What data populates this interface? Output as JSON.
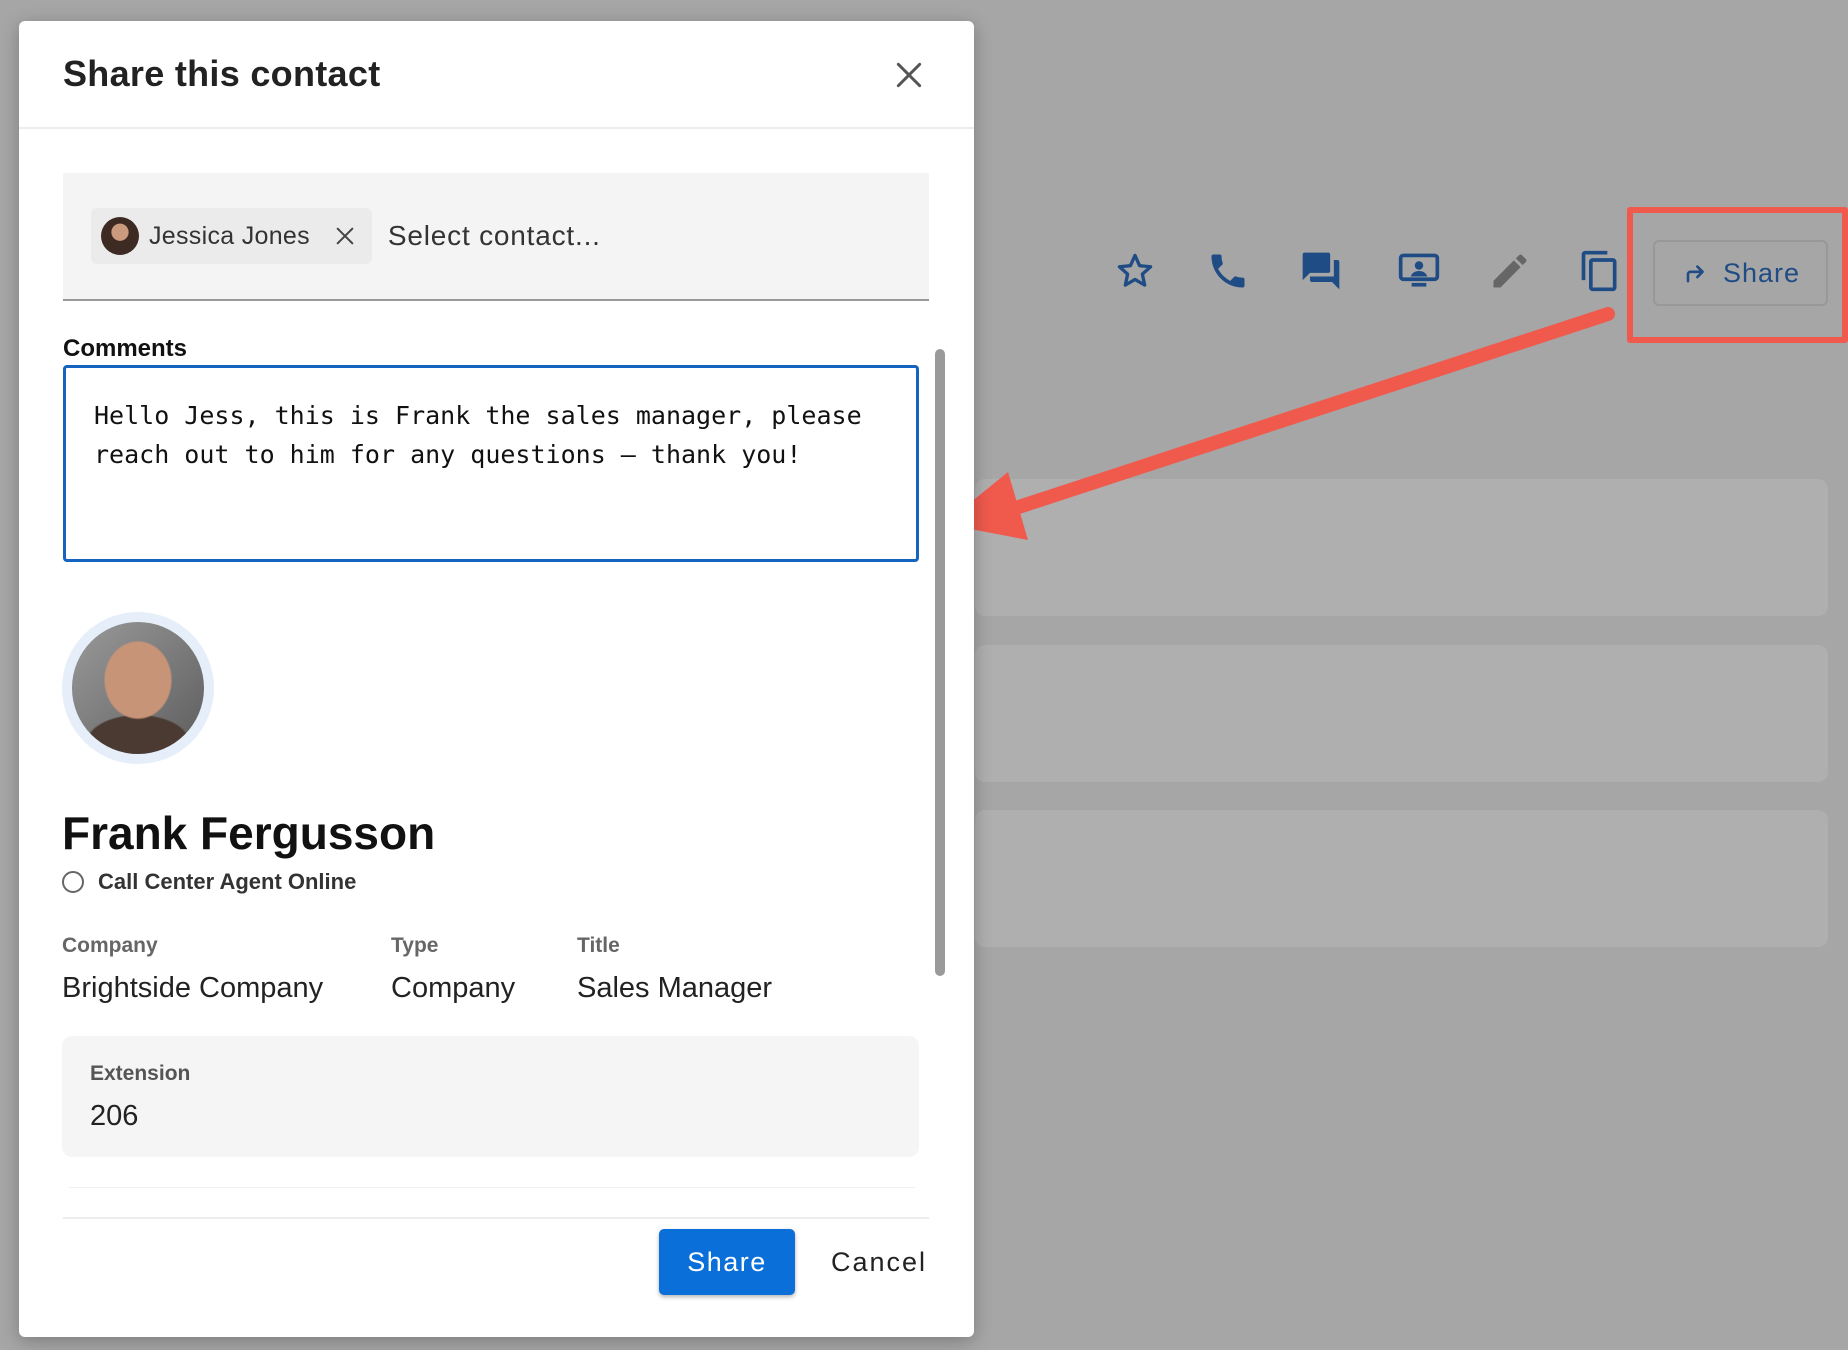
{
  "modal": {
    "title": "Share this contact",
    "recipients": [
      {
        "name": "Jessica Jones"
      }
    ],
    "select_placeholder": "Select contact...",
    "comments_label": "Comments",
    "comments_value": "Hello Jess, this is Frank the sales manager, please reach out to him for any questions – thank you!",
    "contact": {
      "name": "Frank Fergusson",
      "status": "Call Center Agent Online",
      "fields": [
        {
          "label": "Company",
          "value": "Brightside Company"
        },
        {
          "label": "Type",
          "value": "Company"
        },
        {
          "label": "Title",
          "value": "Sales Manager"
        }
      ],
      "extension": {
        "label": "Extension",
        "value": "206"
      }
    },
    "actions": {
      "share_label": "Share",
      "cancel_label": "Cancel"
    }
  },
  "background": {
    "toolbar_icons": [
      "star-icon",
      "phone-icon",
      "chat-icon",
      "screen-share-icon",
      "pencil-icon",
      "copy-icon"
    ],
    "share_button_label": "Share"
  },
  "colors": {
    "primary": "#0a6fd8",
    "icon_blue": "#1f4c85",
    "annotation": "#ef5a4d",
    "focus_border": "#1565c0"
  }
}
